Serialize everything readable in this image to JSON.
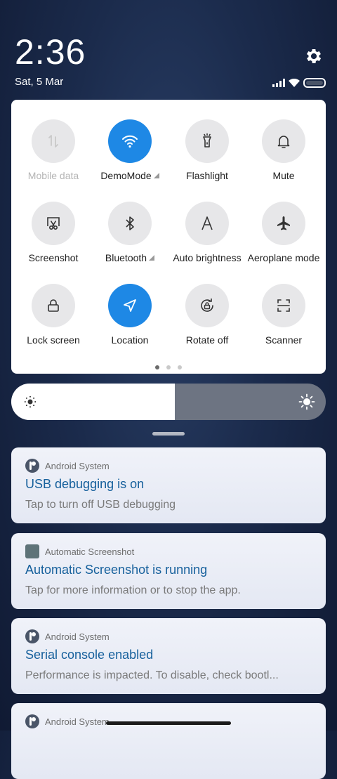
{
  "status_bar": {
    "time": "2:36",
    "date": "Sat, 5 Mar",
    "icons": [
      "signal-icon",
      "wifi-icon",
      "battery-icon"
    ]
  },
  "settings_icon": "gear-icon",
  "quick_settings": {
    "tiles": [
      {
        "label": "Mobile data",
        "icon": "mobile-data-icon",
        "active": false,
        "disabled": true
      },
      {
        "label": "DemoMode",
        "icon": "wifi-icon",
        "active": true,
        "expandable": true
      },
      {
        "label": "Flashlight",
        "icon": "flashlight-icon",
        "active": false
      },
      {
        "label": "Mute",
        "icon": "bell-icon",
        "active": false
      },
      {
        "label": "Screenshot",
        "icon": "screenshot-icon",
        "active": false
      },
      {
        "label": "Bluetooth",
        "icon": "bluetooth-icon",
        "active": false,
        "expandable": true
      },
      {
        "label": "Auto brightness",
        "icon": "auto-brightness-icon",
        "active": false
      },
      {
        "label": "Aeroplane mode",
        "icon": "airplane-icon",
        "active": false
      },
      {
        "label": "Lock screen",
        "icon": "lock-icon",
        "active": false
      },
      {
        "label": "Location",
        "icon": "location-icon",
        "active": true
      },
      {
        "label": "Rotate off",
        "icon": "rotate-lock-icon",
        "active": false
      },
      {
        "label": "Scanner",
        "icon": "scanner-icon",
        "active": false
      }
    ],
    "page_indicator": {
      "pages": 3,
      "current": 1
    }
  },
  "brightness": {
    "level": 0.52
  },
  "notifications": [
    {
      "app": "Android System",
      "icon": "android-system-icon",
      "title": "USB debugging is on",
      "body": "Tap to turn off USB debugging"
    },
    {
      "app": "Automatic Screenshot",
      "icon": "app-square-icon",
      "title": "Automatic Screenshot is running",
      "body": "Tap for more information or to stop the app."
    },
    {
      "app": "Android System",
      "icon": "android-system-icon",
      "title": "Serial console enabled",
      "body": "Performance is impacted. To disable, check bootl..."
    },
    {
      "app": "Android System",
      "icon": "android-system-icon",
      "title": "",
      "body": ""
    }
  ],
  "colors": {
    "accent": "#1e88e5",
    "notification_title": "#16609c"
  }
}
